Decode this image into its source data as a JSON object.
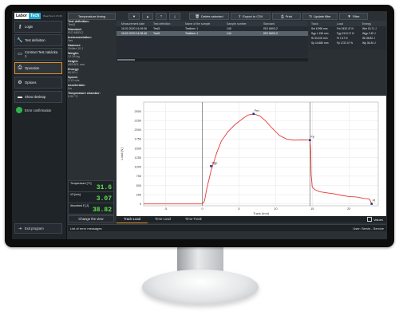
{
  "app": {
    "logo_left": "Labor",
    "logo_right": "Tech",
    "version_text": "BeepTest 2.15.36"
  },
  "sidebar": {
    "items": [
      {
        "label": "Login",
        "icon": "key-icon"
      },
      {
        "label": "Test definition",
        "icon": "wrench-icon"
      },
      {
        "label": "Contract Test zakázka 1",
        "icon": "folder-icon"
      },
      {
        "label": "Operation",
        "icon": "printer-icon",
        "active": true
      },
      {
        "label": "Options",
        "icon": "gear-icon"
      },
      {
        "label": "Show desktop",
        "icon": "desktop-icon"
      }
    ],
    "error_confirmation": "Error confirmation",
    "exit_label": "Exit program"
  },
  "info": {
    "test_definition_label": "Test definition:",
    "test_definition_value": "Test3",
    "standard_label": "Standard:",
    "standard_value": "ISO 6603-2",
    "instrumentation_label": "Instrumentation:",
    "instrumentation_value": "Yes",
    "hammer_label": "Hammer:",
    "hammer_value": "Striker 10 J",
    "weight_label": "Weight:",
    "weight_value": "12.28  kg",
    "height_label": "Height:",
    "height_value": "499.801  mm",
    "energy_label": "Energy:",
    "energy_value": "60.00  J",
    "speed_label": "Speed:",
    "speed_value": "3.13  m/s",
    "accelerator_label": "Accelerator:",
    "accelerator_value": "No",
    "chamber_label": "Temperature chamber:",
    "chamber_value": "0.00 °C"
  },
  "measurements": {
    "temperature_label": "Temperature [°C]",
    "temperature_value": "31.6",
    "v0_label": "V0 [m/s]",
    "v0_value": "3.07",
    "absorbed_label": "Absorbed E [J]",
    "absorbed_value": "38.82"
  },
  "toolbar": {
    "temperature_timing": "Temperature timing",
    "delete_selected": "Delete selected",
    "export_csv": "Export to CSV",
    "print": "Print",
    "update_filter": "Update filter",
    "filter": "Filter"
  },
  "table": {
    "headers": [
      "Measurement date",
      "Test definition",
      "Name of the sample",
      "Sample number",
      "Standard"
    ],
    "rows": [
      [
        "18.02.2020 14:09:06",
        "Test3",
        "TestItem 1",
        "145",
        "ISO 6603-2"
      ],
      [
        "18.02.2020 14:08:46",
        "Test3",
        "TestItem 1",
        "144",
        "ISO 6603-2"
      ]
    ]
  },
  "results": {
    "headers": [
      "Track",
      "Load",
      "Energy"
    ],
    "rows": [
      [
        "Sm 6.996 mm",
        "Fm 2432.47 N",
        "Wm 15.71 J"
      ],
      [
        "Sgp 1.196 mm",
        "Fgp 2113.17 N",
        "Wgp 2.49 J"
      ],
      [
        "St 33.100 mm",
        "Ft 2.17 N",
        "Wt 38.82 J"
      ],
      [
        "Sp 14.680 mm",
        "Fp 1722.07 N",
        "Wp 36.34 J"
      ]
    ]
  },
  "chart_tabs": [
    "Track-Load",
    "Time-Load",
    "Time-Track"
  ],
  "values_label": "Values",
  "change_view": "Change the view",
  "status": {
    "errors_label": "List of error messages",
    "user_label": "User: Servis - Service"
  },
  "chart_data": {
    "type": "line",
    "xlabel": "Track [mm]",
    "ylabel": "Load [N]",
    "xlim": [
      -8,
      24
    ],
    "ylim": [
      -50,
      2750
    ],
    "xticks": [
      -5,
      0,
      5,
      10,
      15,
      20
    ],
    "yticks": [
      0,
      250,
      500,
      750,
      1000,
      1250,
      1500,
      1750,
      2000,
      2250,
      2500
    ],
    "grid": true,
    "series": [
      {
        "color": "#e53935",
        "x": [
          -8,
          0,
          0.3,
          0.6,
          1.2,
          2.0,
          2.6,
          3.5,
          4.5,
          5.5,
          6.2,
          6.996,
          7.8,
          8.6,
          9.5,
          10.5,
          11.5,
          12.5,
          13.5,
          14.3,
          14.68,
          14.8,
          14.85,
          15.0,
          15.4,
          16.0,
          17.0,
          18.0,
          19.0,
          20.0,
          21.0,
          22.0,
          22.8,
          23.1
        ],
        "y": [
          0,
          0,
          80,
          400,
          900,
          1400,
          1700,
          1950,
          2150,
          2300,
          2400,
          2432,
          2380,
          2250,
          2050,
          1850,
          1750,
          1720,
          1730,
          1725,
          1722,
          1400,
          800,
          450,
          380,
          330,
          300,
          270,
          230,
          200,
          190,
          150,
          130,
          2
        ]
      }
    ],
    "annotations": [
      {
        "label": "Fgp",
        "x": 1.196,
        "y": 1020
      },
      {
        "label": "Fm",
        "x": 6.996,
        "y": 2432
      },
      {
        "label": "Fp",
        "x": 14.68,
        "y": 1722
      },
      {
        "label": "Ft",
        "x": 23.1,
        "y": 2
      }
    ],
    "vlines": [
      0,
      14.68
    ]
  }
}
